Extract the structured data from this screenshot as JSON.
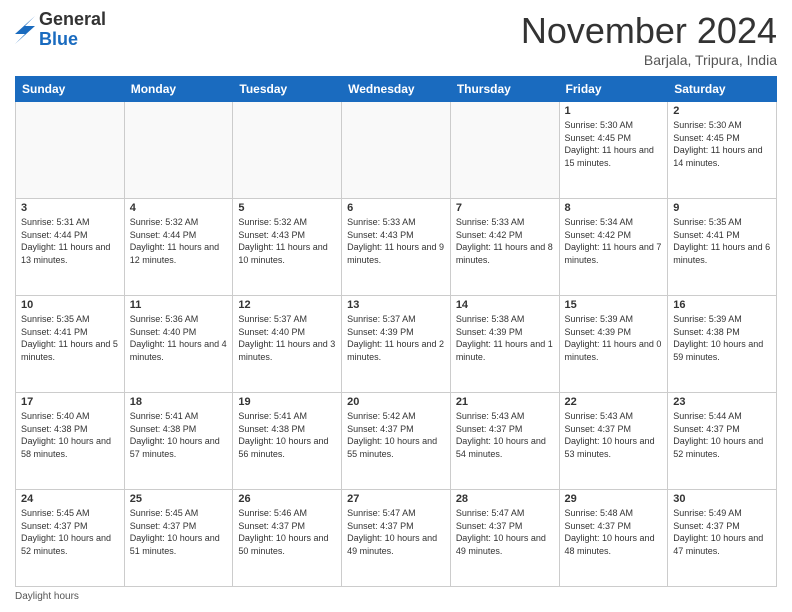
{
  "logo": {
    "general": "General",
    "blue": "Blue"
  },
  "header": {
    "month": "November 2024",
    "location": "Barjala, Tripura, India"
  },
  "weekdays": [
    "Sunday",
    "Monday",
    "Tuesday",
    "Wednesday",
    "Thursday",
    "Friday",
    "Saturday"
  ],
  "weeks": [
    [
      {
        "day": "",
        "info": ""
      },
      {
        "day": "",
        "info": ""
      },
      {
        "day": "",
        "info": ""
      },
      {
        "day": "",
        "info": ""
      },
      {
        "day": "",
        "info": ""
      },
      {
        "day": "1",
        "info": "Sunrise: 5:30 AM\nSunset: 4:45 PM\nDaylight: 11 hours and 15 minutes."
      },
      {
        "day": "2",
        "info": "Sunrise: 5:30 AM\nSunset: 4:45 PM\nDaylight: 11 hours and 14 minutes."
      }
    ],
    [
      {
        "day": "3",
        "info": "Sunrise: 5:31 AM\nSunset: 4:44 PM\nDaylight: 11 hours and 13 minutes."
      },
      {
        "day": "4",
        "info": "Sunrise: 5:32 AM\nSunset: 4:44 PM\nDaylight: 11 hours and 12 minutes."
      },
      {
        "day": "5",
        "info": "Sunrise: 5:32 AM\nSunset: 4:43 PM\nDaylight: 11 hours and 10 minutes."
      },
      {
        "day": "6",
        "info": "Sunrise: 5:33 AM\nSunset: 4:43 PM\nDaylight: 11 hours and 9 minutes."
      },
      {
        "day": "7",
        "info": "Sunrise: 5:33 AM\nSunset: 4:42 PM\nDaylight: 11 hours and 8 minutes."
      },
      {
        "day": "8",
        "info": "Sunrise: 5:34 AM\nSunset: 4:42 PM\nDaylight: 11 hours and 7 minutes."
      },
      {
        "day": "9",
        "info": "Sunrise: 5:35 AM\nSunset: 4:41 PM\nDaylight: 11 hours and 6 minutes."
      }
    ],
    [
      {
        "day": "10",
        "info": "Sunrise: 5:35 AM\nSunset: 4:41 PM\nDaylight: 11 hours and 5 minutes."
      },
      {
        "day": "11",
        "info": "Sunrise: 5:36 AM\nSunset: 4:40 PM\nDaylight: 11 hours and 4 minutes."
      },
      {
        "day": "12",
        "info": "Sunrise: 5:37 AM\nSunset: 4:40 PM\nDaylight: 11 hours and 3 minutes."
      },
      {
        "day": "13",
        "info": "Sunrise: 5:37 AM\nSunset: 4:39 PM\nDaylight: 11 hours and 2 minutes."
      },
      {
        "day": "14",
        "info": "Sunrise: 5:38 AM\nSunset: 4:39 PM\nDaylight: 11 hours and 1 minute."
      },
      {
        "day": "15",
        "info": "Sunrise: 5:39 AM\nSunset: 4:39 PM\nDaylight: 11 hours and 0 minutes."
      },
      {
        "day": "16",
        "info": "Sunrise: 5:39 AM\nSunset: 4:38 PM\nDaylight: 10 hours and 59 minutes."
      }
    ],
    [
      {
        "day": "17",
        "info": "Sunrise: 5:40 AM\nSunset: 4:38 PM\nDaylight: 10 hours and 58 minutes."
      },
      {
        "day": "18",
        "info": "Sunrise: 5:41 AM\nSunset: 4:38 PM\nDaylight: 10 hours and 57 minutes."
      },
      {
        "day": "19",
        "info": "Sunrise: 5:41 AM\nSunset: 4:38 PM\nDaylight: 10 hours and 56 minutes."
      },
      {
        "day": "20",
        "info": "Sunrise: 5:42 AM\nSunset: 4:37 PM\nDaylight: 10 hours and 55 minutes."
      },
      {
        "day": "21",
        "info": "Sunrise: 5:43 AM\nSunset: 4:37 PM\nDaylight: 10 hours and 54 minutes."
      },
      {
        "day": "22",
        "info": "Sunrise: 5:43 AM\nSunset: 4:37 PM\nDaylight: 10 hours and 53 minutes."
      },
      {
        "day": "23",
        "info": "Sunrise: 5:44 AM\nSunset: 4:37 PM\nDaylight: 10 hours and 52 minutes."
      }
    ],
    [
      {
        "day": "24",
        "info": "Sunrise: 5:45 AM\nSunset: 4:37 PM\nDaylight: 10 hours and 52 minutes."
      },
      {
        "day": "25",
        "info": "Sunrise: 5:45 AM\nSunset: 4:37 PM\nDaylight: 10 hours and 51 minutes."
      },
      {
        "day": "26",
        "info": "Sunrise: 5:46 AM\nSunset: 4:37 PM\nDaylight: 10 hours and 50 minutes."
      },
      {
        "day": "27",
        "info": "Sunrise: 5:47 AM\nSunset: 4:37 PM\nDaylight: 10 hours and 49 minutes."
      },
      {
        "day": "28",
        "info": "Sunrise: 5:47 AM\nSunset: 4:37 PM\nDaylight: 10 hours and 49 minutes."
      },
      {
        "day": "29",
        "info": "Sunrise: 5:48 AM\nSunset: 4:37 PM\nDaylight: 10 hours and 48 minutes."
      },
      {
        "day": "30",
        "info": "Sunrise: 5:49 AM\nSunset: 4:37 PM\nDaylight: 10 hours and 47 minutes."
      }
    ]
  ],
  "footer": {
    "note": "Daylight hours"
  }
}
